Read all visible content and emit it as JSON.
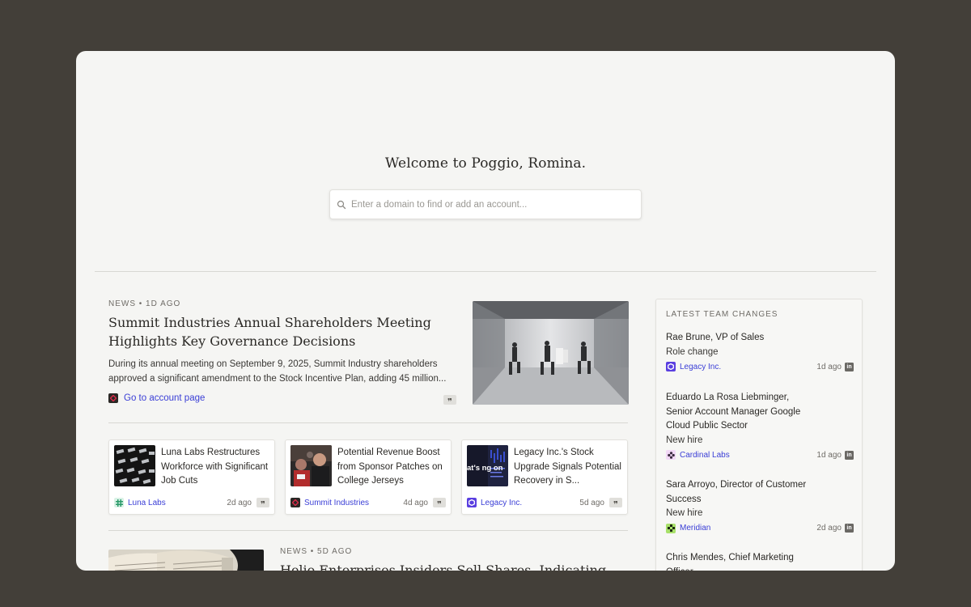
{
  "app": {
    "welcome": "Welcome to Poggio, Romina.",
    "search_placeholder": "Enter a domain to find or add an account..."
  },
  "featured": {
    "meta": "NEWS • 1D AGO",
    "title": "Summit Industries Annual Shareholders Meeting Highlights Key Governance Decisions",
    "body": "During its annual meeting on September 9, 2025, Summit Industry shareholders approved a significant amendment to the Stock Incentive Plan, adding 45 million...",
    "link": "Go to account page"
  },
  "cards": [
    {
      "title": "Luna Labs Restructures Workforce with Significant Job Cuts",
      "company": "Luna Labs",
      "ago": "2d ago"
    },
    {
      "title": "Potential Revenue Boost from Sponsor Patches on College Jerseys",
      "company": "Summit Industries",
      "ago": "4d ago"
    },
    {
      "title": "Legacy Inc.'s Stock Upgrade Signals Potential Recovery in S...",
      "company": "Legacy Inc.",
      "ago": "5d ago"
    }
  ],
  "thumb_text": "at's ng on",
  "bottom": {
    "meta": "NEWS • 5D AGO",
    "title": "Helio Enterprises Insiders Sell Shares, Indicating"
  },
  "team_changes": {
    "header": "LATEST TEAM CHANGES",
    "items": [
      {
        "name": "Rae Brune, VP of Sales",
        "type": "Role change",
        "company": "Legacy Inc.",
        "ago": "1d ago"
      },
      {
        "name": "Eduardo La Rosa Liebminger, Senior Account Manager Google Cloud Public Sector",
        "type": "New hire",
        "company": "Cardinal Labs",
        "ago": "1d ago"
      },
      {
        "name": "Sara Arroyo, Director of Customer Success",
        "type": "New hire",
        "company": "Meridian",
        "ago": "2d ago"
      },
      {
        "name": "Chris Mendes, Chief Marketing Officer",
        "type": "",
        "company": "",
        "ago": ""
      }
    ]
  },
  "icons": {
    "quote": "❞",
    "linkedin": "in"
  },
  "colors": {
    "background": "#433f39",
    "window": "#f5f5f3",
    "link": "#3a3ed6",
    "legacy": "#5a3fe0",
    "summit": "#d92b4a",
    "luna": "#3cc08a",
    "cardinal": "#c24ad6",
    "meridian": "#7cc63a"
  }
}
